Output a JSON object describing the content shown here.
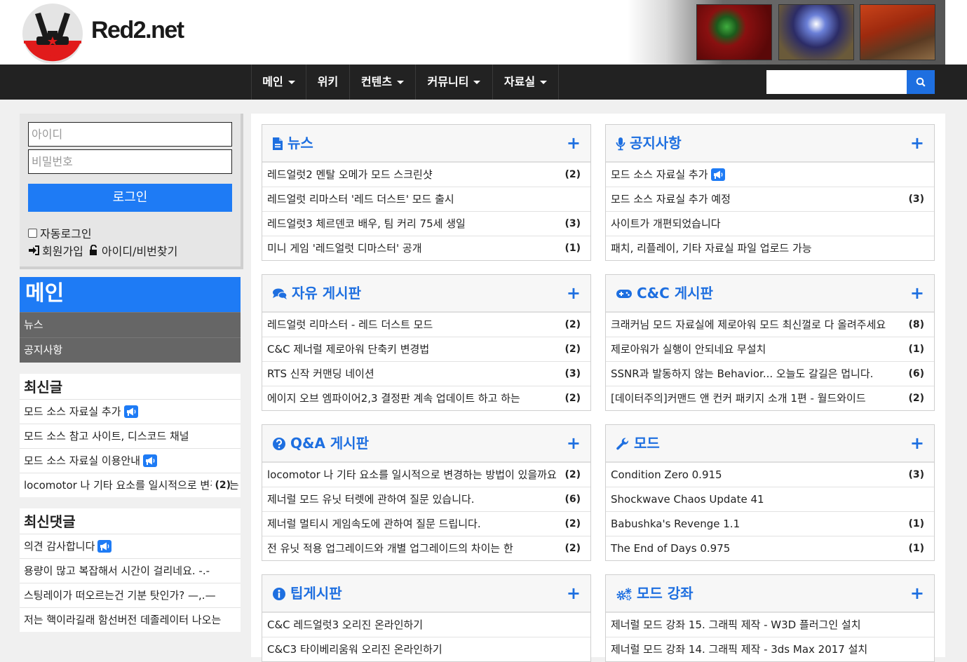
{
  "site": {
    "name": "Red2.net"
  },
  "nav": {
    "items": [
      {
        "label": "메인",
        "dropdown": true
      },
      {
        "label": "위키",
        "dropdown": false
      },
      {
        "label": "컨텐츠",
        "dropdown": true
      },
      {
        "label": "커뮤니티",
        "dropdown": true
      },
      {
        "label": "자료실",
        "dropdown": true
      }
    ],
    "search_placeholder": ""
  },
  "login": {
    "id_placeholder": "아이디",
    "pw_placeholder": "비밀번호",
    "button": "로그인",
    "auto_login": "자동로그인",
    "join": "회원가입",
    "find": "아이디/비번찾기"
  },
  "sidebar": {
    "menu_title": "메인",
    "menu_items": [
      "뉴스",
      "공지사항"
    ],
    "recent_posts": {
      "title": "최신글",
      "items": [
        {
          "text": "모드 소스 자료실 추가",
          "badge": true,
          "count": ""
        },
        {
          "text": "모드 소스 참고 사이트, 디스코드 채널",
          "badge": false,
          "count": ""
        },
        {
          "text": "모드 소스 자료실 이용안내",
          "badge": true,
          "count": ""
        },
        {
          "text": "locomotor 나 기타 요소를 일시적으로 변경하는",
          "badge": false,
          "count": "(2)"
        }
      ]
    },
    "recent_comments": {
      "title": "최신댓글",
      "items": [
        {
          "text": "의견 감사합니다",
          "badge": true
        },
        {
          "text": "용량이 많고 복잡해서 시간이 걸리네요. -.-",
          "badge": false
        },
        {
          "text": "스팅레이가 떠오르는건 기분 탓인가? —,.—",
          "badge": false
        },
        {
          "text": "저는 핵이라길래 함선버전 데졸레이터 나오는",
          "badge": false
        }
      ]
    }
  },
  "panels": [
    {
      "title": "뉴스",
      "icon": "file-icon",
      "rows": [
        {
          "text": "레드얼럿2 멘탈 오메가 모드 스크린샷",
          "count": "(2)"
        },
        {
          "text": "레드얼럿 리마스터 '레드 더스트' 모드 출시",
          "count": ""
        },
        {
          "text": "레드얼럿3 체르덴코 배우, 팀 커리 75세 생일",
          "count": "(3)"
        },
        {
          "text": "미니 게임 '레드얼럿 디마스터' 공개",
          "count": "(1)"
        }
      ]
    },
    {
      "title": "공지사항",
      "icon": "microphone-icon",
      "rows": [
        {
          "text": "모드 소스 자료실 추가",
          "count": "",
          "badge": true
        },
        {
          "text": "모드 소스 자료실 추가 예정",
          "count": "(3)"
        },
        {
          "text": "사이트가 개편되었습니다",
          "count": ""
        },
        {
          "text": "패치, 리플레이, 기타 자료실 파일 업로드 가능",
          "count": ""
        }
      ]
    },
    {
      "title": "자유 게시판",
      "icon": "comments-icon",
      "rows": [
        {
          "text": "레드얼럿 리마스터 - 레드 더스트 모드",
          "count": "(2)"
        },
        {
          "text": "C&C 제너럴 제로아워 단축키 변경법",
          "count": "(2)"
        },
        {
          "text": "RTS 신작 커맨딩 네이션",
          "count": "(3)"
        },
        {
          "text": "에이지 오브 엠파이어2,3 결정판 계속 업데이트 하고 하는",
          "count": "(2)"
        }
      ]
    },
    {
      "title": "C&C 게시판",
      "icon": "gamepad-icon",
      "rows": [
        {
          "text": "크래커님 모드 자료실에 제로아워 모드 최신껄로 다 올려주세요",
          "count": "(8)"
        },
        {
          "text": "제로아워가 실행이 안되네요 무설치",
          "count": "(1)"
        },
        {
          "text": "SSNR과 발동하지 않는 Behavior... 오늘도 갈길은 멉니다.",
          "count": "(6)"
        },
        {
          "text": "[데이터주의]커맨드 앤 컨커 패키지 소개 1편 - 월드와이드",
          "count": "(2)"
        }
      ]
    },
    {
      "title": "Q&A 게시판",
      "icon": "question-icon",
      "rows": [
        {
          "text": "locomotor 나 기타 요소를 일시적으로 변경하는 방법이 있을까요",
          "count": "(2)"
        },
        {
          "text": "제너럴 모드 유닛 터렛에 관하여 질문 있습니다.",
          "count": "(6)"
        },
        {
          "text": "제너럴 멀티시 게임속도에 관하여 질문 드립니다.",
          "count": "(2)"
        },
        {
          "text": "전 유닛 적용 업그레이드와 개별 업그레이드의 차이는 한",
          "count": "(2)"
        }
      ]
    },
    {
      "title": "모드",
      "icon": "wrench-icon",
      "rows": [
        {
          "text": "Condition Zero 0.915",
          "count": "(3)"
        },
        {
          "text": "Shockwave Chaos Update 41",
          "count": ""
        },
        {
          "text": "Babushka's Revenge 1.1",
          "count": "(1)"
        },
        {
          "text": "The End of Days 0.975",
          "count": "(1)"
        }
      ]
    },
    {
      "title": "팁게시판",
      "icon": "info-icon",
      "rows": [
        {
          "text": "C&C 레드얼럿3 오리진 온라인하기",
          "count": ""
        },
        {
          "text": "C&C3 타이베리움워 오리진 온라인하기",
          "count": ""
        }
      ]
    },
    {
      "title": "모드 강좌",
      "icon": "cogs-icon",
      "rows": [
        {
          "text": "제너럴 모드 강좌 15. 그래픽 제작 - W3D 플러그인 설치",
          "count": ""
        },
        {
          "text": "제너럴 모드 강좌 14. 그래픽 제작 - 3ds Max 2017 설치",
          "count": ""
        }
      ]
    }
  ],
  "plus": "+",
  "colors": {
    "accent": "#1e6fe0",
    "button": "#1e7bf5",
    "nav_bg": "#222222"
  }
}
